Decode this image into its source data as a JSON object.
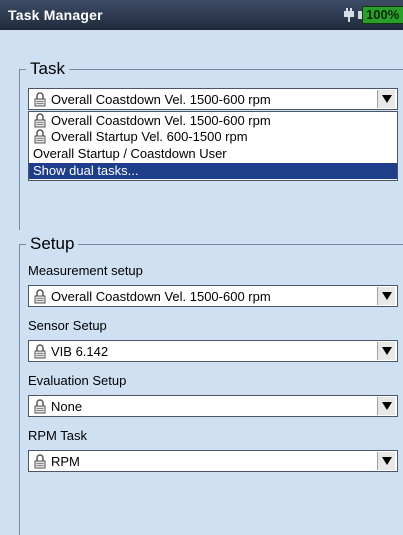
{
  "app": {
    "title": "Task Manager",
    "battery": "100%"
  },
  "task": {
    "legend": "Task",
    "selected": "Overall Coastdown Vel. 1500-600 rpm",
    "options": [
      {
        "label": "Overall Coastdown Vel. 1500-600 rpm",
        "locked": true
      },
      {
        "label": "Overall Startup Vel. 600-1500 rpm",
        "locked": true
      },
      {
        "label": "Overall Startup / Coastdown User",
        "locked": false
      },
      {
        "label": "Show dual tasks...",
        "locked": false
      }
    ],
    "highlighted_option": "Show dual tasks..."
  },
  "setup": {
    "legend": "Setup",
    "measurement_label": "Measurement setup",
    "measurement_value": "Overall Coastdown Vel. 1500-600 rpm",
    "sensor_label": "Sensor Setup",
    "sensor_value": "VIB 6.142",
    "evaluation_label": "Evaluation Setup",
    "evaluation_value": "None",
    "rpm_label": "RPM Task",
    "rpm_value": "RPM"
  },
  "icons": {
    "plug": "plug-icon",
    "battery": "battery-icon",
    "lock": "lock-icon",
    "arrow": "dropdown-arrow-icon"
  },
  "colors": {
    "background": "#cfe0f3",
    "titlebar": "#2a3750",
    "selection": "#1e3d8a",
    "battery": "#2aa02a"
  }
}
